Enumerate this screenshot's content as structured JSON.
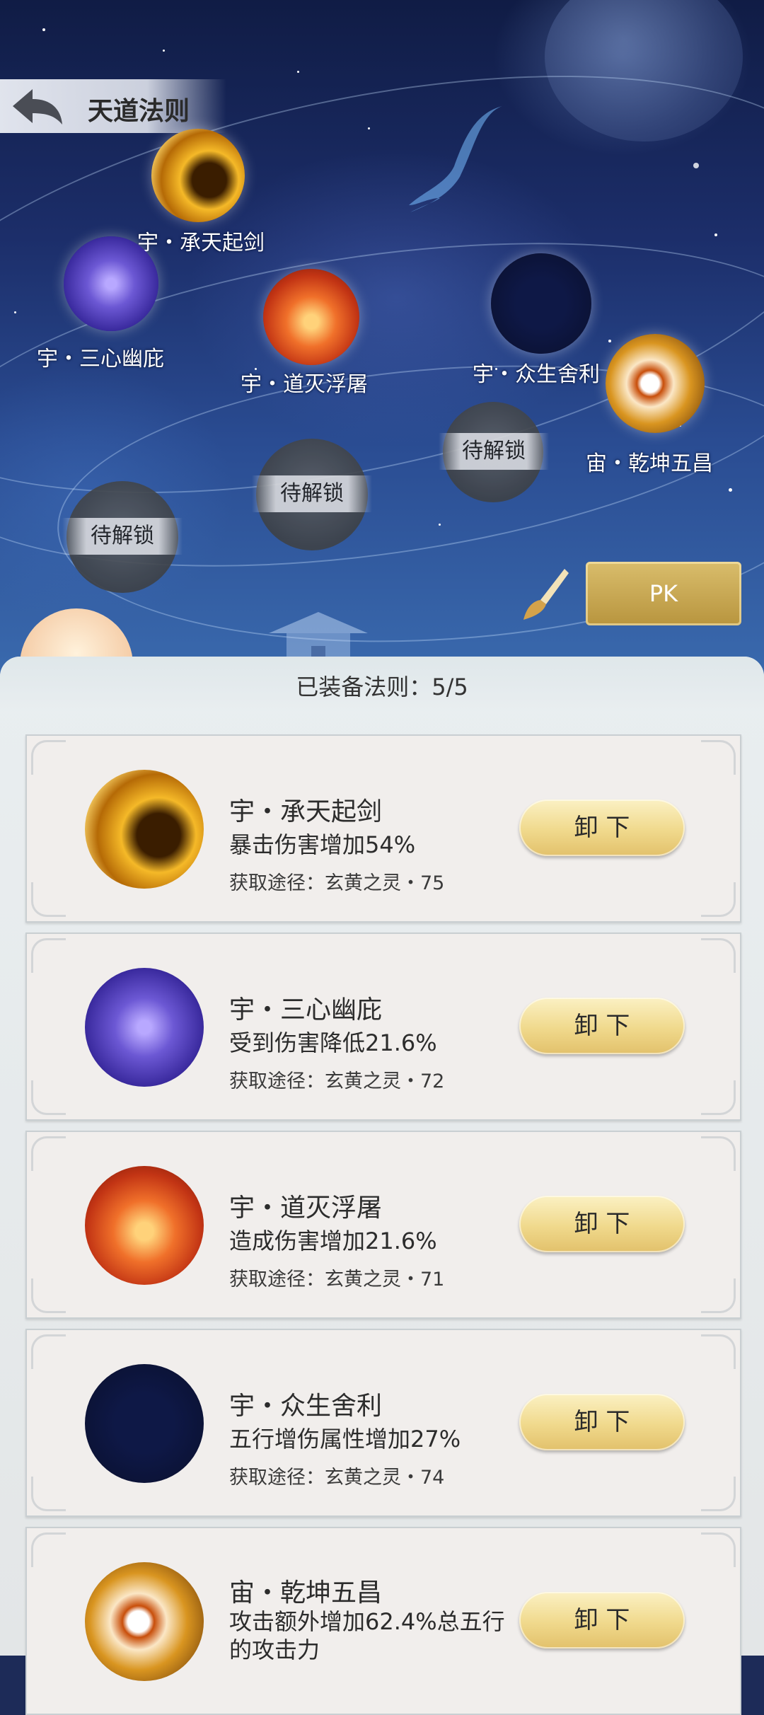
{
  "header": {
    "title": "天道法则",
    "back_icon": "back-arrow-icon"
  },
  "laws_map": {
    "nodes": [
      {
        "label": "宇・承天起剑",
        "orb": "gold"
      },
      {
        "label": "宇・三心幽庇",
        "orb": "purple"
      },
      {
        "label": "宇・道灭浮屠",
        "orb": "red"
      },
      {
        "label": "宇・众生舍利",
        "orb": "cosmic"
      },
      {
        "label": "宙・乾坤五昌",
        "orb": "eye"
      }
    ],
    "locked": [
      {
        "label": "待解锁"
      },
      {
        "label": "待解锁"
      },
      {
        "label": "待解锁"
      }
    ]
  },
  "pk_button": {
    "label": "PK",
    "icon": "brush-icon"
  },
  "panel": {
    "equipped_label": "已装备法则：5/5",
    "cards": [
      {
        "name": "宇・承天起剑",
        "effect": "暴击伤害增加54%",
        "source": "获取途径：玄黄之灵・75",
        "button": "卸 下",
        "orb": "gold"
      },
      {
        "name": "宇・三心幽庇",
        "effect": "受到伤害降低21.6%",
        "source": "获取途径：玄黄之灵・72",
        "button": "卸 下",
        "orb": "purple"
      },
      {
        "name": "宇・道灭浮屠",
        "effect": "造成伤害增加21.6%",
        "source": "获取途径：玄黄之灵・71",
        "button": "卸 下",
        "orb": "red"
      },
      {
        "name": "宇・众生舍利",
        "effect": "五行增伤属性增加27%",
        "source": "获取途径：玄黄之灵・74",
        "button": "卸 下",
        "orb": "cosmic"
      },
      {
        "name": "宙・乾坤五昌",
        "effect": "攻击额外增加62.4%总五行的攻击力",
        "source": "",
        "button": "卸 下",
        "orb": "eye"
      }
    ]
  },
  "colors": {
    "pk_gold": "#c9a851",
    "button_gold": "#f0d98c",
    "panel_bg": "#e9eef0",
    "card_bg": "#f1eeec"
  }
}
